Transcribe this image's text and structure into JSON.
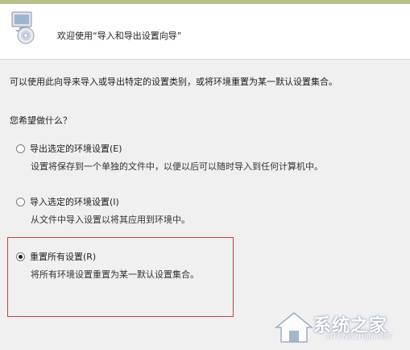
{
  "header": {
    "title": "欢迎使用“导入和导出设置向导”",
    "icon": "computer-disc-icon"
  },
  "description": "可以使用此向导来导入或导出特定的设置类别，或将环境重置为某一默认设置集合。",
  "question": "您希望做什么？",
  "options": [
    {
      "label": "导出选定的环境设置(E)",
      "description": "设置将保存到一个单独的文件中，以便以后可以随时导入到任何计算机中。",
      "selected": false
    },
    {
      "label": "导入选定的环境设置(I)",
      "description": "从文件中导入设置以将其应用到环境中。",
      "selected": false
    },
    {
      "label": "重置所有设置(R)",
      "description": "将所有环境设置重置为某一默认设置集合。",
      "selected": true
    }
  ],
  "highlight_color": "#c0443c",
  "watermark": {
    "text": "系统之家",
    "url": "XITONGZHIJIA.NET",
    "icon": "house-logo-icon"
  }
}
